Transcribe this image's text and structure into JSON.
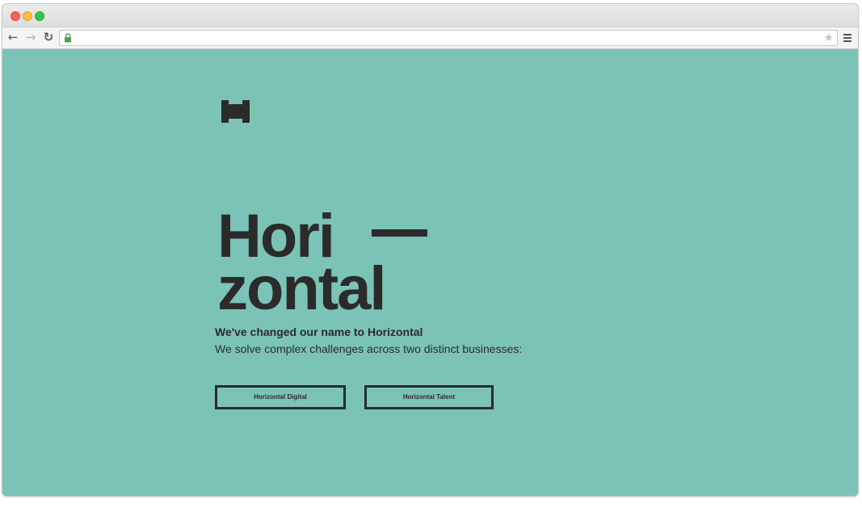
{
  "browser": {
    "address": "",
    "icons": {
      "back": "arrow-left-icon",
      "forward": "arrow-right-icon",
      "reload": "reload-icon",
      "secure": "lock-icon",
      "bookmark": "star-icon",
      "menu": "hamburger-menu-icon"
    },
    "glyphs": {
      "back": "←",
      "forward": "→",
      "reload": "↻",
      "bookmark": "★"
    }
  },
  "page": {
    "background_color": "#7bc3b7",
    "ink_color": "#2b2b2b",
    "logo_icon": "horizontal-h-logo-icon",
    "wordmark_line1": "Hori",
    "wordmark_line2": "zontal",
    "headline": "We've changed our name to Horizontal",
    "subline": "We solve complex challenges across two distinct businesses:",
    "buttons": [
      {
        "label": "Horizontal Digital"
      },
      {
        "label": "Horizontal Talent"
      }
    ]
  }
}
